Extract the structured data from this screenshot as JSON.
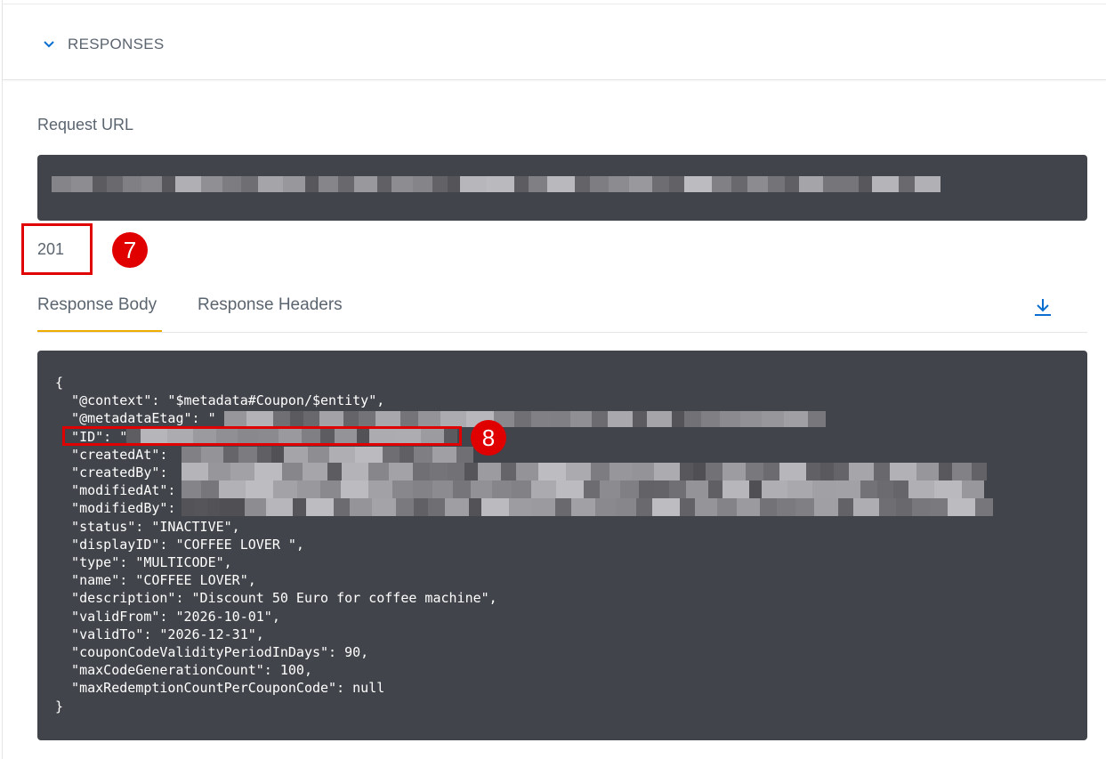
{
  "section": {
    "title": "RESPONSES",
    "chevron_icon": "chevron-down-icon"
  },
  "request": {
    "label": "Request URL"
  },
  "status": {
    "code": "201"
  },
  "markers": {
    "status": "7",
    "id": "8"
  },
  "tabs": [
    {
      "label": "Response Body",
      "active": true
    },
    {
      "label": "Response Headers",
      "active": false
    }
  ],
  "download_icon": "download-icon",
  "body_lines": [
    "{",
    "  \"@context\": \"$metadata#Coupon/$entity\",",
    "  \"@metadataEtag\": \"",
    "  \"ID\": \"",
    "  \"createdAt\":",
    "  \"createdBy\":",
    "  \"modifiedAt\":",
    "  \"modifiedBy\":",
    "  \"status\": \"INACTIVE\",",
    "  \"displayID\": \"COFFEE LOVER \",",
    "  \"type\": \"MULTICODE\",",
    "  \"name\": \"COFFEE LOVER\",",
    "  \"description\": \"Discount 50 Euro for coffee machine\",",
    "  \"validFrom\": \"2026-10-01\",",
    "  \"validTo\": \"2026-12-31\",",
    "  \"couponCodeValidityPeriodInDays\": 90,",
    "  \"maxCodeGenerationCount\": 100,",
    "  \"maxRedemptionCountPerCouponCode\": null",
    "}"
  ],
  "colors": {
    "accent": "#f0ab00",
    "marker": "#e00000",
    "code_bg": "#41444a",
    "link": "#0a6ed1"
  }
}
